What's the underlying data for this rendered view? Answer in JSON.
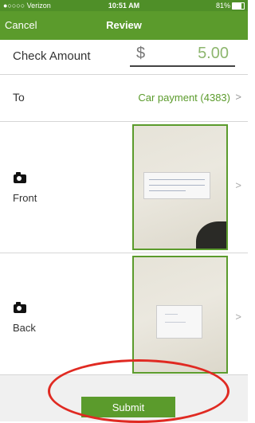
{
  "status_bar": {
    "carrier": "●○○○○ Verizon",
    "time": "10:51 AM",
    "battery": "81%"
  },
  "nav": {
    "cancel": "Cancel",
    "title": "Review"
  },
  "amount": {
    "label": "Check Amount",
    "currency": "$",
    "value": "5.00"
  },
  "to": {
    "label": "To",
    "account": "Car payment (4383)",
    "chevron": ">"
  },
  "front": {
    "label": "Front",
    "chevron": ">"
  },
  "back": {
    "label": "Back",
    "chevron": ">"
  },
  "submit": {
    "label": "Submit"
  },
  "colors": {
    "brand_green": "#5b9b2c",
    "annotation_red": "#e02a22"
  },
  "icons": {
    "camera": "camera-icon",
    "chevron": "chevron-right-icon"
  }
}
